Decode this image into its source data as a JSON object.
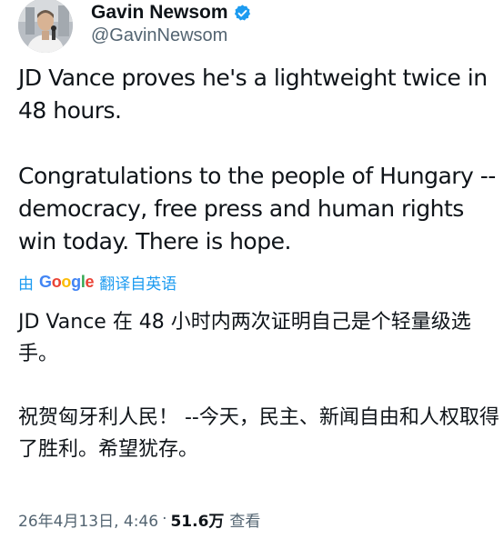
{
  "author": {
    "display_name": "Gavin Newsom",
    "handle": "@GavinNewsom",
    "verified": true,
    "verified_color": "#1d9bf0"
  },
  "tweet": {
    "paragraphs": [
      "JD Vance proves he's a lightweight twice in 48 hours.",
      "Congratulations to the people of Hungary -- democracy, free press and human rights win today. There is hope."
    ]
  },
  "translation": {
    "prefix": "由",
    "provider_letters": [
      "G",
      "o",
      "o",
      "g",
      "l",
      "e"
    ],
    "suffix": "翻译自英语",
    "paragraphs": [
      "JD Vance 在 48 小时内两次证明自己是个轻量级选手。",
      "祝贺匈牙利人民！ --今天，民主、新闻自由和人权取得了胜利。希望犹存。"
    ]
  },
  "meta": {
    "timestamp": "26年4月13日, 4:46",
    "separator": "·",
    "view_count": "51.6万",
    "views_label": "查看"
  },
  "colors": {
    "text_primary": "#0f1419",
    "text_secondary": "#536471",
    "link_blue": "#1d9bf0"
  }
}
